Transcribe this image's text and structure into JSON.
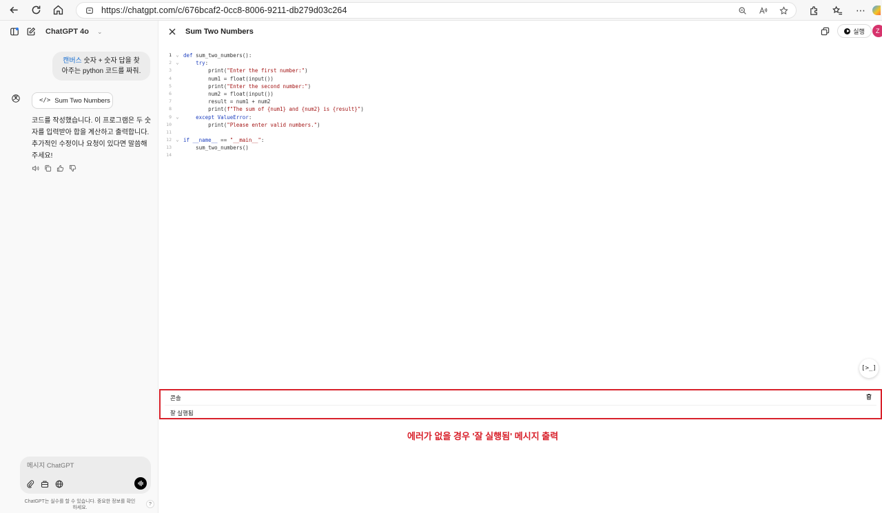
{
  "browser": {
    "url": "https://chatgpt.com/c/676bcaf2-0cc8-8006-9211-db279d03c264"
  },
  "chat": {
    "model_name": "ChatGPT 4o",
    "user_message_highlight": "캔버스",
    "user_message_rest": " 숫자 + 숫자 답을 찾아주는 python 코드를 짜줘.",
    "canvas_chip_label": "Sum Two Numbers",
    "assistant_message": "코드를 작성했습니다. 이 프로그램은 두 숫자를 입력받아 합을 계산하고 출력합니다. 추가적인 수정이나 요청이 있다면 말씀해 주세요!",
    "composer_placeholder": "메시지 ChatGPT",
    "disclaimer": "ChatGPT는 실수를 할 수 있습니다. 중요한 정보를 확인하세요.",
    "help": "?"
  },
  "canvas": {
    "title": "Sum Two Numbers",
    "run_label": "실행",
    "avatar_letter": "Z",
    "side_tool": "[>_]",
    "code_lines": [
      "def sum_two_numbers():",
      "    try:",
      "        print(\"Enter the first number:\")",
      "        num1 = float(input())",
      "        print(\"Enter the second number:\")",
      "        num2 = float(input())",
      "        result = num1 + num2",
      "        print(f\"The sum of {num1} and {num2} is {result}\")",
      "    except ValueError:",
      "        print(\"Please enter valid numbers.\")",
      "",
      "if __name__ == \"__main__\":",
      "    sum_two_numbers()",
      ""
    ]
  },
  "console": {
    "title": "콘솔",
    "output": "잘 실행됨"
  },
  "annotation": "에러가 없을 경우 '잘 실행됨' 메시지 출력",
  "colors": {
    "annotation_red": "#d8202a",
    "keyword_blue": "#1d3fbf",
    "string_red": "#a31515",
    "avatar_pink": "#d6336c"
  }
}
